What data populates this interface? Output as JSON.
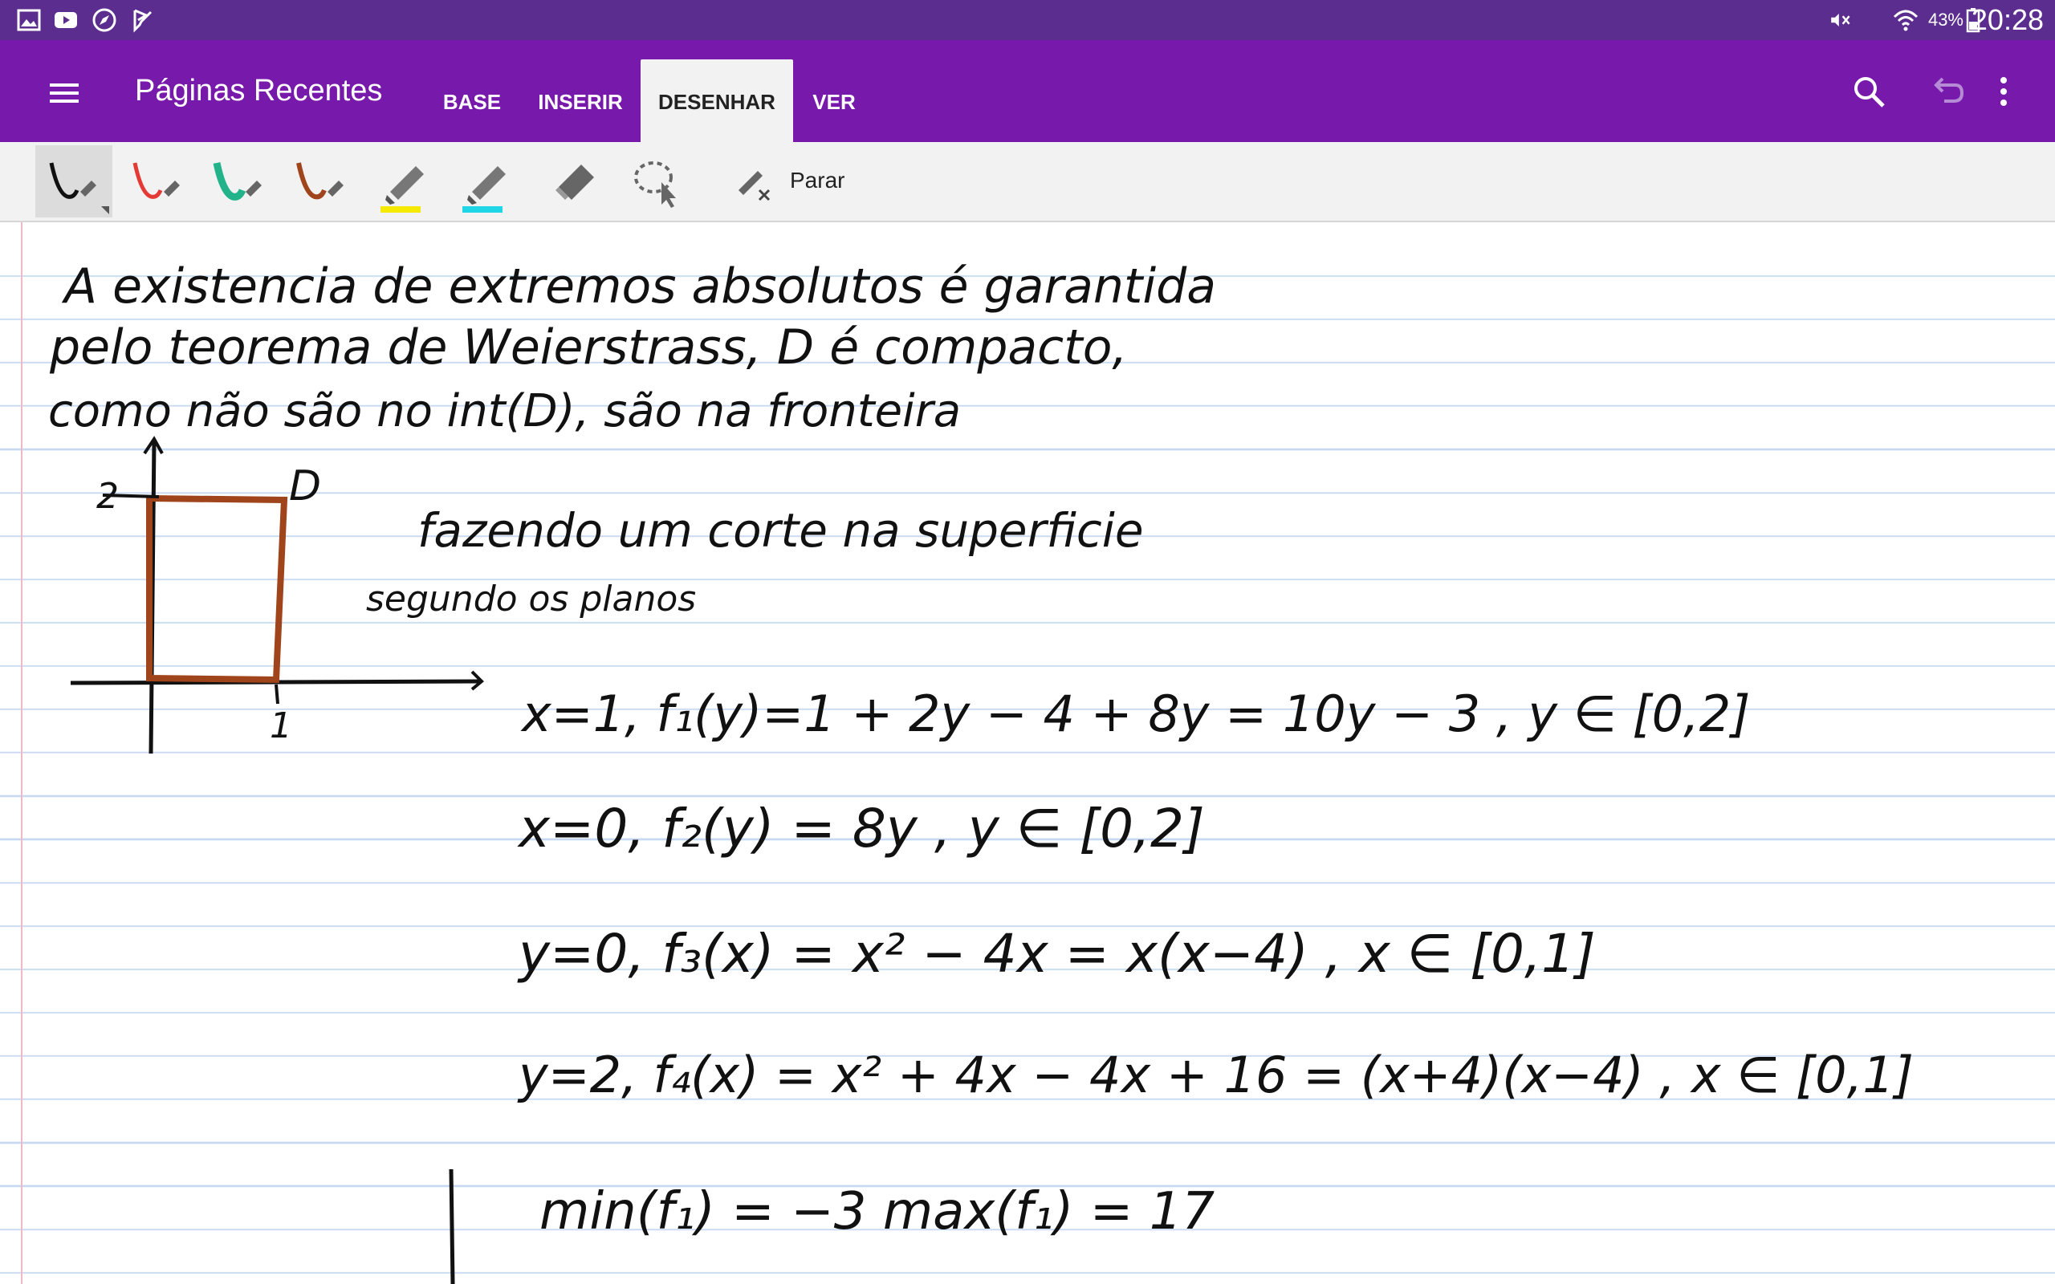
{
  "status_bar": {
    "time": "20:28",
    "battery": "43%",
    "left_icons": [
      "gallery-icon",
      "youtube-icon",
      "compass-icon",
      "check-flag-icon"
    ],
    "right_icons": [
      "mute-icon",
      "wifi-icon",
      "battery-icon"
    ]
  },
  "app_bar": {
    "title": "Páginas Recentes",
    "tabs": [
      {
        "label": "BASE",
        "active": false
      },
      {
        "label": "INSERIR",
        "active": false
      },
      {
        "label": "DESENHAR",
        "active": true
      },
      {
        "label": "VER",
        "active": false
      }
    ],
    "icons": [
      "menu-icon",
      "search-icon",
      "undo-icon",
      "more-vert-icon"
    ]
  },
  "draw_toolbar": {
    "tools": [
      {
        "name": "black-pen-icon",
        "color": "#111111",
        "selected": true
      },
      {
        "name": "red-pen-icon",
        "color": "#e53935",
        "selected": false
      },
      {
        "name": "green-pen-icon",
        "color": "#22b38a",
        "selected": false
      },
      {
        "name": "brown-pen-icon",
        "color": "#a0441c",
        "selected": false
      },
      {
        "name": "yellow-highlighter-icon",
        "color": "#f5e900",
        "selected": false
      },
      {
        "name": "cyan-highlighter-icon",
        "color": "#1ed6e6",
        "selected": false
      },
      {
        "name": "eraser-icon",
        "color": "#555555",
        "selected": false
      },
      {
        "name": "lasso-select-icon",
        "color": "#555555",
        "selected": false
      }
    ],
    "stop_label": "Parar"
  },
  "page": {
    "ink_lines": [
      "A existencia de extremos absolutos é garantida",
      "pelo teorema de Weierstrass, D é compacto,",
      "como não são no int(D), são na fronteira",
      "fazendo um corte na superficie",
      "segundo os planos",
      "x=1, f₁(y)=1 + 2y − 4 + 8y = 10y − 3 , y ∈ [0,2]",
      "x=0, f₂(y) = 8y , y ∈ [0,2]",
      "y=0, f₃(x) = x² − 4x = x(x−4) , x ∈ [0,1]",
      "y=2, f₄(x) = x² + 4x − 4x + 16 = (x+4)(x−4) , x ∈ [0,1]",
      "min(f₁) = −3     max(f₁) = 17"
    ],
    "sketch_labels": {
      "y_tick": "2",
      "x_tick": "1",
      "region": "D"
    },
    "ink_colors": {
      "text": "#111111",
      "region": "#a0441c",
      "rule_lines": "#c6d9f1",
      "margin": "#f3b8c6"
    }
  }
}
